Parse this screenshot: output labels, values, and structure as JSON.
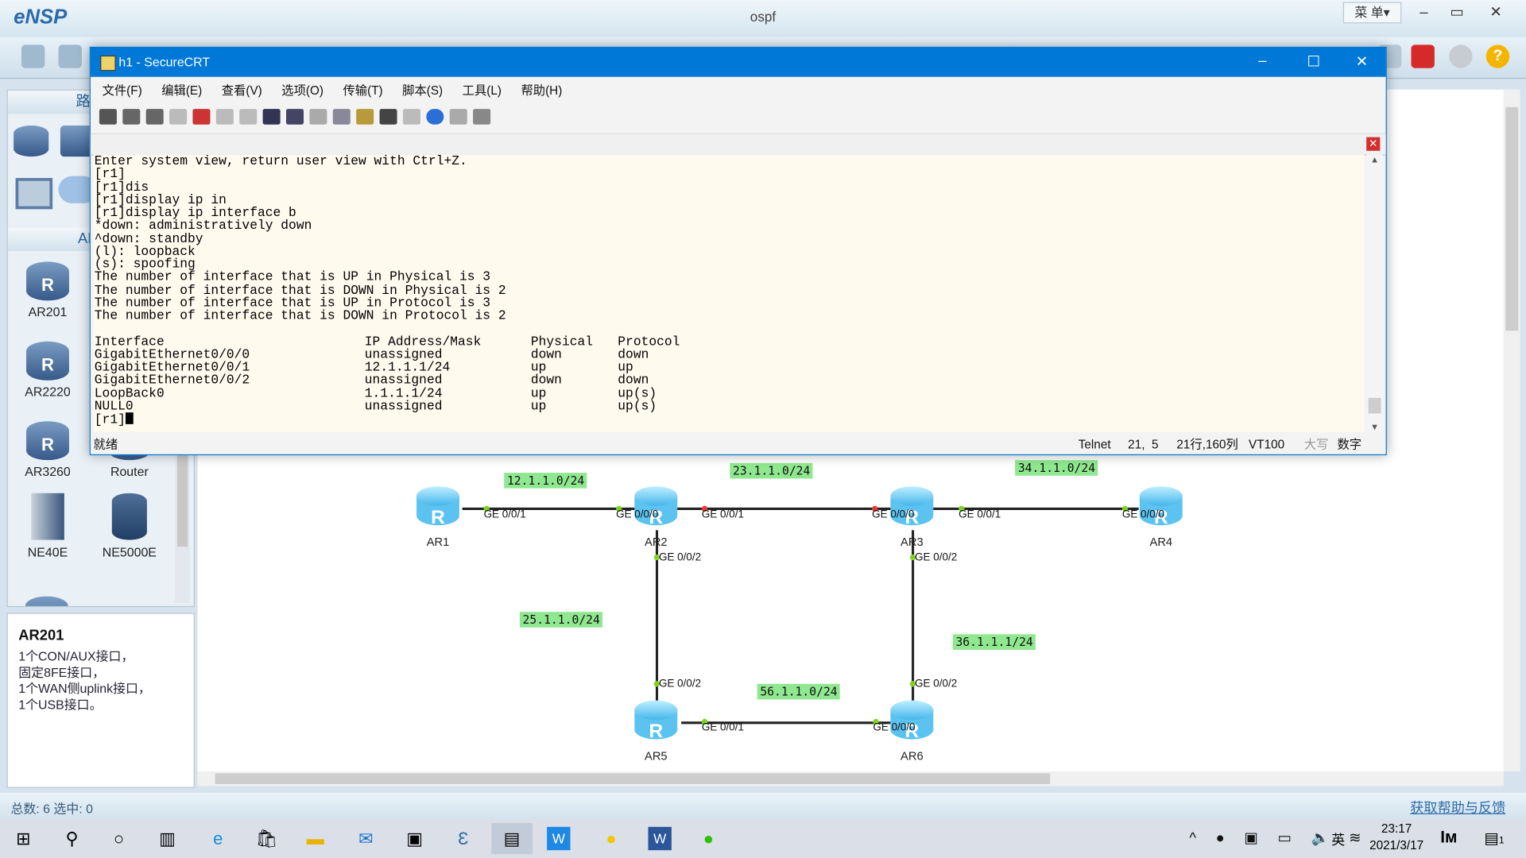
{
  "ensp": {
    "logo": "eNSP",
    "title": "ospf",
    "menu_label": "菜 单▾",
    "left_panel": {
      "tab_top": "路",
      "section": "AR",
      "devices": [
        "AR201",
        "AR2220",
        "AR3260",
        "Router",
        "NE40E",
        "NE5000E"
      ],
      "info_title": "AR201",
      "info_desc": "1个CON/AUX接口，\n固定8FE接口，\n1个WAN侧uplink接口，\n1个USB接口。"
    },
    "topology": {
      "routers": [
        "AR1",
        "AR2",
        "AR3",
        "AR4",
        "AR5",
        "AR6"
      ],
      "networks": [
        "12.1.1.0/24",
        "23.1.1.0/24",
        "34.1.1.0/24",
        "25.1.1.0/24",
        "36.1.1.1/24",
        "56.1.1.0/24"
      ],
      "ports": {
        "ar1_g1": "GE 0/0/1",
        "ar2_g0": "GE 0/0/0",
        "ar2_g1": "GE 0/0/1",
        "ar2_g2": "GE 0/0/2",
        "ar3_g0": "GE 0/0/0",
        "ar3_g1": "GE 0/0/1",
        "ar3_g2": "GE 0/0/2",
        "ar4_g0": "GE 0/0/0",
        "ar5_g2": "GE 0/0/2",
        "ar5_g1": "GE 0/0/1",
        "ar6_g2": "GE 0/0/2",
        "ar6_g0": "GE 0/0/0"
      },
      "colors": {
        "link": "#222222",
        "up_dot": "#7ed321",
        "down_dot": "#e53935",
        "net_label_bg": "#8fe88f"
      }
    },
    "status": {
      "left": "总数: 6 选中: 0",
      "help": "获取帮助与反馈"
    }
  },
  "crt": {
    "title": "h1 - SecureCRT",
    "menu": [
      "文件(F)",
      "编辑(E)",
      "查看(V)",
      "选项(O)",
      "传输(T)",
      "脚本(S)",
      "工具(L)",
      "帮助(H)"
    ],
    "terminal_lines": [
      "Enter system view, return user view with Ctrl+Z.",
      "[r1]",
      "[r1]dis",
      "[r1]display ip in",
      "[r1]display ip interface b",
      "*down: administratively down",
      "^down: standby",
      "(l): loopback",
      "(s): spoofing",
      "The number of interface that is UP in Physical is 3",
      "The number of interface that is DOWN in Physical is 2",
      "The number of interface that is UP in Protocol is 3",
      "The number of interface that is DOWN in Protocol is 2",
      ""
    ],
    "table": {
      "headers": [
        "Interface",
        "IP Address/Mask",
        "Physical",
        "Protocol"
      ],
      "rows": [
        [
          "GigabitEthernet0/0/0",
          "unassigned",
          "down",
          "down"
        ],
        [
          "GigabitEthernet0/0/1",
          "12.1.1.1/24",
          "up",
          "up"
        ],
        [
          "GigabitEthernet0/0/2",
          "unassigned",
          "down",
          "down"
        ],
        [
          "LoopBack0",
          "1.1.1.1/24",
          "up",
          "up(s)"
        ],
        [
          "NULL0",
          "unassigned",
          "up",
          "up(s)"
        ]
      ]
    },
    "prompt": "[r1]",
    "status": {
      "ready": "就绪",
      "protocol": "Telnet",
      "cursor": "21,  5",
      "size": "21行,160列",
      "emulation": "VT100",
      "caps": "大写",
      "num": "数字"
    },
    "accent": "#0078d7"
  },
  "taskbar": {
    "time": "23:17",
    "date": "2021/3/17",
    "ime": "英",
    "notifications": "1"
  }
}
